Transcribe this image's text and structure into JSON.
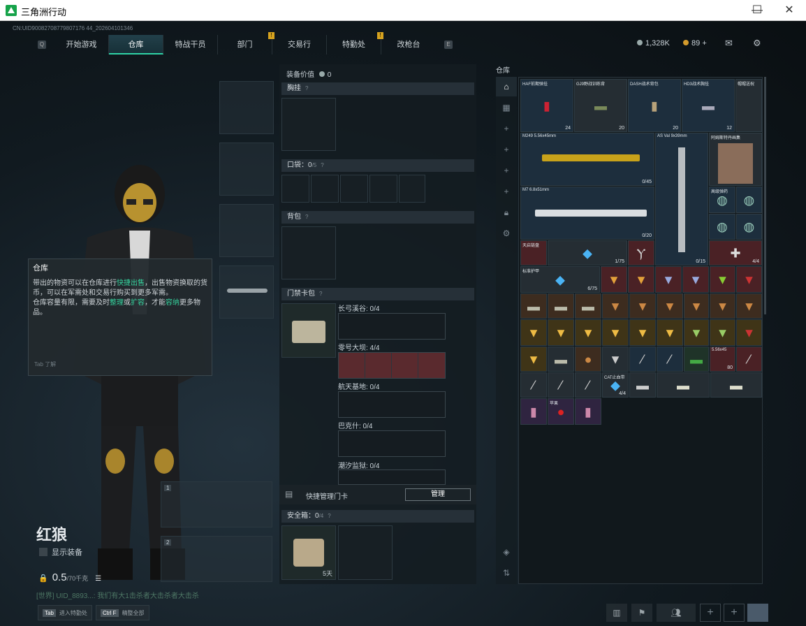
{
  "window": {
    "title": "三角洲行动",
    "minimize": "—",
    "maximize": "☐",
    "close": "✕"
  },
  "uid": "CN:UID90082708779807176 44_202604101346",
  "nav": {
    "left_key": "Q",
    "right_key": "E",
    "tabs": [
      {
        "label": "开始游戏"
      },
      {
        "label": "仓库",
        "active": true
      },
      {
        "label": "特战干员"
      },
      {
        "label": "部门",
        "badge": "!"
      },
      {
        "label": "交易行"
      },
      {
        "label": "特勤处",
        "badge": "!"
      },
      {
        "label": "改枪台"
      }
    ]
  },
  "currency": {
    "hafcoin": "1,328K",
    "diamonds": "89",
    "plus": "+"
  },
  "tooltip": {
    "title": "仓库",
    "body_1": "带出的物资可以在仓库进行",
    "hl_1": "快捷出售",
    "body_2": "，出售物资换取的货币，可以在军需处和交易行购买到更多军需。",
    "body_3": "仓库容量有限，需要及时",
    "hl_2": "整理",
    "body_4": "或",
    "hl_3": "扩容",
    "body_5": "，才能",
    "hl_4": "容纳",
    "body_6": "更多物品。",
    "footer": "Tab  了解"
  },
  "operator": {
    "name": "红狼",
    "show_equipment": "显示装备",
    "weight": "0.5",
    "weight_cap": "/70千克"
  },
  "chat_line": "[世界] UID_8893...: 我们有大1击杀者大击杀者大击杀",
  "bottom_keys": [
    {
      "key": "Tab",
      "label": "进入特勤处"
    },
    {
      "key": "Ctrl F",
      "label": "精整全部"
    }
  ],
  "equipment": {
    "value_label": "装备价值",
    "value": "0",
    "chest_rig": "胸挂",
    "pocket": "口袋：",
    "pocket_count": "0",
    "pocket_cap": "/5",
    "backpack": "背包",
    "keycard_bag": "门禁卡包",
    "keycard_slots": [
      {
        "label": "长弓溪谷: 0/4"
      },
      {
        "label": "零号大坝: 4/4"
      },
      {
        "label": "航天基地: 0/4"
      },
      {
        "label": "巴克什: 0/4"
      },
      {
        "label": "潮汐监狱: 0/4"
      }
    ],
    "quick_manage": "快捷管理门卡",
    "manage_btn": "管理",
    "safebox": "安全箱：",
    "safebox_count": "0",
    "safebox_cap": "/4",
    "safebox_days": "5天",
    "question": "?"
  },
  "warehouse": {
    "label": "仓库",
    "items": [
      {
        "name": "HAF前期弹挂",
        "count": "24"
      },
      {
        "name": "GJ9野战训练背",
        "count": "20"
      },
      {
        "name": "DASH战术背包",
        "count": "20"
      },
      {
        "name": "HD3战术胸挂",
        "count": "12"
      },
      {
        "name": "帽帽送祝",
        "count": ""
      },
      {
        "name": "M249 5.56x45mm",
        "count": "0/45"
      },
      {
        "name": "AS Val 9x39mm",
        "count": "0/15"
      },
      {
        "name": "M7 6.8x51mm",
        "count": "0/20"
      },
      {
        "name": "阿姆斯特丹画集",
        "count": ""
      },
      {
        "name": "高级弹药",
        "count": ""
      },
      {
        "name": "天启链盘",
        "count": "1/75"
      },
      {
        "name": "标准护甲",
        "count": "6/75"
      },
      {
        "name": "战术手术包",
        "count": "4/4"
      },
      {
        "name": "5.56x45",
        "count": "80"
      },
      {
        "name": "CAT止血带",
        "count": "4/4"
      },
      {
        "name": "苹果",
        "count": ""
      }
    ]
  }
}
